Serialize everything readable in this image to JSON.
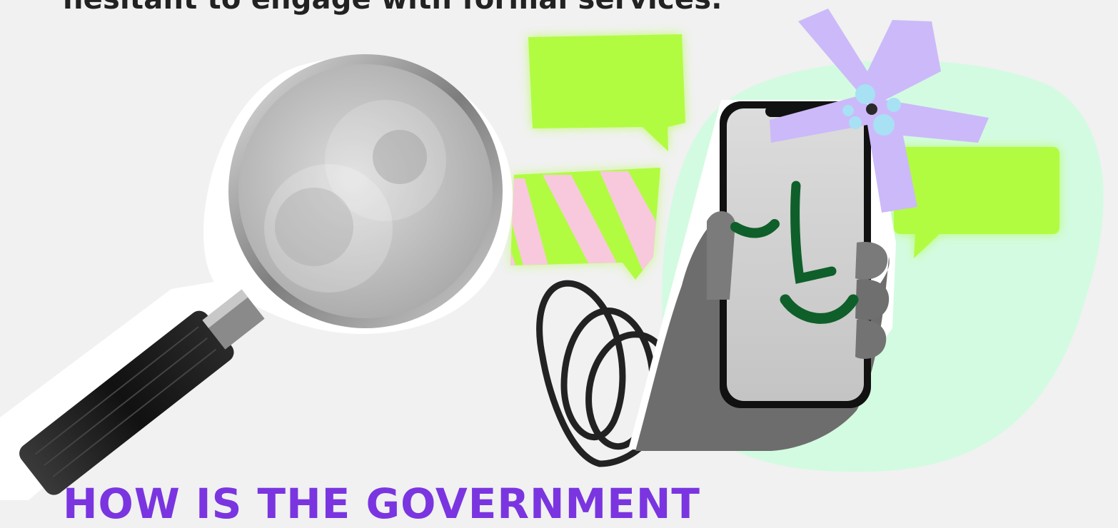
{
  "page": {
    "top_text": "hesitant to engage with formal services.",
    "bottom_heading": "HOW IS THE GOVERNMENT"
  },
  "illustration": {
    "magnifier": "magnifying-glass",
    "phone": "hand-holding-smartphone",
    "flower": "flower-sticker",
    "bubbles": [
      "speech-bubble",
      "speech-bubble",
      "speech-bubble"
    ],
    "scribble": "scribble",
    "colors": {
      "background": "#f0f1f0",
      "mint_blob": "#d3fbe1",
      "lime": "#b1fc41",
      "lavender": "#ccb9f9",
      "pink_stripe": "#f8c9dd",
      "face_green": "#0f5f2a",
      "heading_purple": "#7a35e0"
    }
  }
}
